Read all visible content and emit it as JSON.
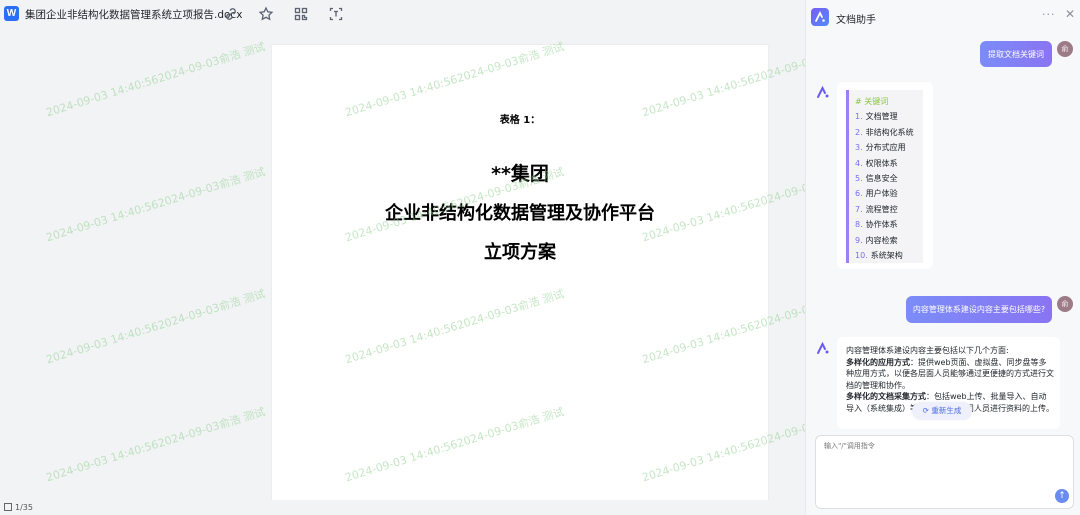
{
  "app": {
    "doc_title": "集团企业非结构化数据管理系统立项报告.docx",
    "word_badge": "W",
    "icons": [
      "link-icon",
      "star-icon",
      "grid-icon",
      "scan-icon"
    ]
  },
  "document": {
    "table_label": "表格 1：",
    "title_line1": "**集团",
    "title_line2": "企业非结构化数据管理及协作平台",
    "title_line3": "立项方案",
    "watermark": "2024-09-03 14:40:562024-09-03俞浩 测试"
  },
  "status": {
    "page_count": "1/35"
  },
  "assistant": {
    "title": "文档助手",
    "more": "···",
    "close": "✕",
    "user_avatar": "俞",
    "msg1": "提取文档关键词",
    "keywords_head": "# 关键词",
    "keywords": [
      {
        "n": "1.",
        "t": "文档管理"
      },
      {
        "n": "2.",
        "t": "非结构化系统"
      },
      {
        "n": "3.",
        "t": "分布式应用"
      },
      {
        "n": "4.",
        "t": "权限体系"
      },
      {
        "n": "5.",
        "t": "信息安全"
      },
      {
        "n": "6.",
        "t": "用户体验"
      },
      {
        "n": "7.",
        "t": "流程管控"
      },
      {
        "n": "8.",
        "t": "协作体系"
      },
      {
        "n": "9.",
        "t": "内容检索"
      },
      {
        "n": "10.",
        "t": "系统架构"
      }
    ],
    "msg2": "内容管理体系建设内容主要包括哪些?",
    "answer_intro": "内容管理体系建设内容主要包括以下几个方面:",
    "answer_h1": "多样化的应用方式",
    "answer_p1": "：提供web页面、虚拟盘、同步盘等多种应用方式，以便各层面人员能够通过更便捷的方式进行文档的管理和协作。",
    "answer_h2": "多样化的文档采集方式",
    "answer_p2": "：包括web上传、批量导入、自动导入（系统集成）等方式，方便公司人员进行资料的上传。",
    "regen": "重新生成",
    "input_placeholder": "输入\"/\"调用指令",
    "send": "↑"
  }
}
